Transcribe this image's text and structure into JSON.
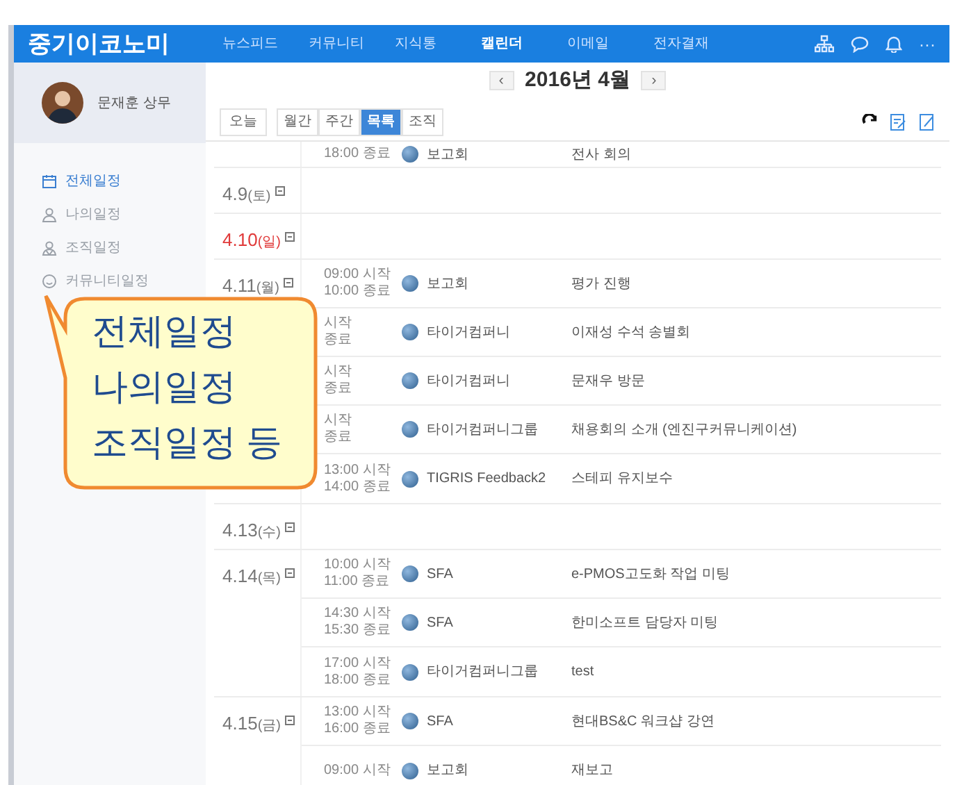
{
  "header": {
    "logo": "중기이코노미",
    "more": "···",
    "nav": [
      {
        "label": "뉴스피드",
        "selected": false
      },
      {
        "label": "커뮤니티",
        "selected": false
      },
      {
        "label": "지식통",
        "selected": false
      },
      {
        "label": "캘린더",
        "selected": true
      },
      {
        "label": "이메일",
        "selected": false
      },
      {
        "label": "전자결재",
        "selected": false
      }
    ]
  },
  "profile": {
    "name": "문재훈 상무"
  },
  "sidebar": {
    "items": [
      {
        "label": "전체일정",
        "selected": true
      },
      {
        "label": "나의일정",
        "selected": false
      },
      {
        "label": "조직일정",
        "selected": false
      },
      {
        "label": "커뮤니티일정",
        "selected": false
      }
    ]
  },
  "calendar": {
    "prev": "‹",
    "month": "2016년 4월",
    "next": "›",
    "today": "오늘",
    "views": [
      {
        "label": "월간",
        "selected": false
      },
      {
        "label": "주간",
        "selected": false
      },
      {
        "label": "목록",
        "selected": true
      },
      {
        "label": "조직",
        "selected": false
      }
    ],
    "days": [
      {
        "events": [
          {
            "end": "18:00 종료",
            "group": "보고회",
            "title": "전사 회의"
          }
        ]
      },
      {
        "date": "4.9",
        "weekday": "(토)",
        "holiday": false
      },
      {
        "date": "4.10",
        "weekday": "(일)",
        "holiday": true
      },
      {
        "date": "4.11",
        "weekday": "(월)",
        "holiday": false,
        "events": [
          {
            "start": "09:00 시작",
            "end": "10:00 종료",
            "group": "보고회",
            "title": "평가 진행"
          },
          {
            "start": "시작",
            "end": "종료",
            "group": "타이거컴퍼니",
            "title": "이재성 수석 송별회"
          },
          {
            "start": "시작",
            "end": "종료",
            "group": "타이거컴퍼니",
            "title": "문재우 방문"
          },
          {
            "start": "시작",
            "end": "종료",
            "group": "타이거컴퍼니그룹",
            "title": "채용회의 소개 (엔진구커뮤니케이션)"
          },
          {
            "start": "13:00 시작",
            "end": "14:00 종료",
            "group": "TIGRIS Feedback2",
            "title": "스테피 유지보수"
          }
        ]
      },
      {
        "date": "4.13",
        "weekday": "(수)",
        "holiday": false
      },
      {
        "date": "4.14",
        "weekday": "(목)",
        "holiday": false,
        "events": [
          {
            "start": "10:00 시작",
            "end": "11:00 종료",
            "group": "SFA",
            "title": "e-PMOS고도화 작업 미팅"
          },
          {
            "start": "14:30 시작",
            "end": "15:30 종료",
            "group": "SFA",
            "title": "한미소프트 담당자 미팅"
          },
          {
            "start": "17:00 시작",
            "end": "18:00 종료",
            "group": "타이거컴퍼니그룹",
            "title": "test"
          }
        ]
      },
      {
        "date": "4.15",
        "weekday": "(금)",
        "holiday": false,
        "events": [
          {
            "start": "13:00 시작",
            "end": "16:00 종료",
            "group": "SFA",
            "title": "현대BS&C 워크샵 강연"
          },
          {
            "start": "09:00 시작",
            "group": "보고회",
            "title": "재보고"
          }
        ]
      }
    ]
  },
  "callout": {
    "lines": [
      "전체일정",
      "나의일정",
      "조직일정 등"
    ]
  }
}
